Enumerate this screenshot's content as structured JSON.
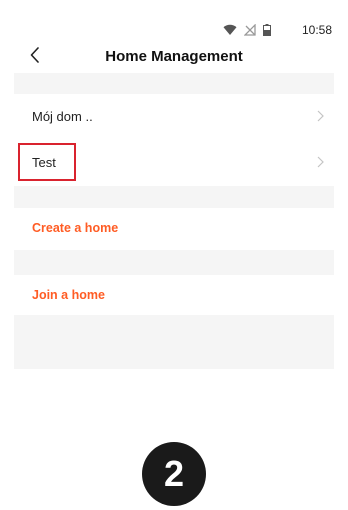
{
  "status_bar": {
    "time": "10:58",
    "icons": [
      "wifi-icon",
      "no-signal-icon",
      "battery-icon"
    ]
  },
  "header": {
    "title": "Home Management",
    "back_icon": "chevron-left-icon"
  },
  "homes": [
    {
      "label": "Mój dom .."
    },
    {
      "label": "Test"
    }
  ],
  "actions": {
    "create_label": "Create a home",
    "join_label": "Join a home"
  },
  "step_badge": "2",
  "colors": {
    "accent": "#ff5c24",
    "highlight": "#d9232e",
    "section_gap": "#f5f5f5",
    "badge": "#1a1a1a"
  }
}
